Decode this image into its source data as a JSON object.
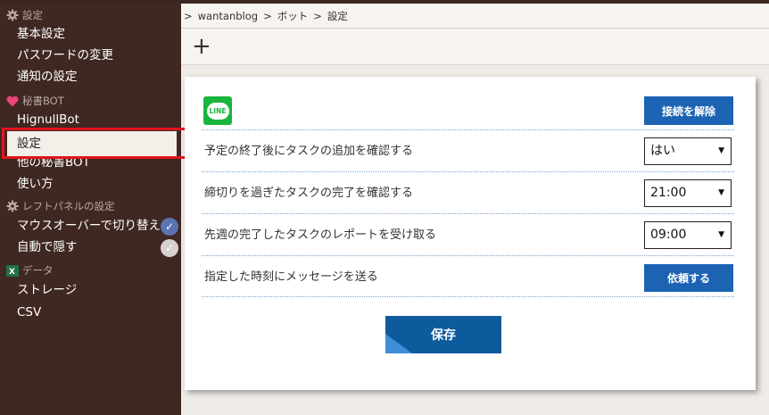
{
  "sidebar": {
    "settings_header": "設定",
    "settings_items": [
      "基本設定",
      "パスワードの変更",
      "通知の設定"
    ],
    "bot_header": "秘書BOT",
    "bot_items": [
      "HignullBot",
      "設定",
      "他の秘書BOT",
      "使い方"
    ],
    "leftpanel_header": "レフトパネルの設定",
    "leftpanel_items": [
      "マウスオーバーで切り替え",
      "自動で隠す"
    ],
    "leftpanel_toggles": [
      "on",
      "off"
    ],
    "data_header": "データ",
    "data_items": [
      "ストレージ",
      "CSV"
    ]
  },
  "breadcrumb": [
    ">",
    "wantanblog",
    ">",
    "ボット",
    ">",
    "設定"
  ],
  "toolbar": {
    "add": "+"
  },
  "panel": {
    "logo_text": "LINE",
    "disconnect_button": "接続を解除",
    "rows": [
      {
        "label": "予定の終了後にタスクの追加を確認する",
        "value": "はい"
      },
      {
        "label": "締切りを過ぎたタスクの完了を確認する",
        "value": "21:00"
      },
      {
        "label": "先週の完了したタスクのレポートを受け取る",
        "value": "09:00"
      },
      {
        "label": "指定した時刻にメッセージを送る",
        "button": "依頼する"
      }
    ],
    "save_button": "保存"
  },
  "colors": {
    "sidebar_bg": "#3f2722",
    "accent_blue": "#1c63b4",
    "line_green": "#19b53c",
    "highlight_red": "#e1141c"
  }
}
